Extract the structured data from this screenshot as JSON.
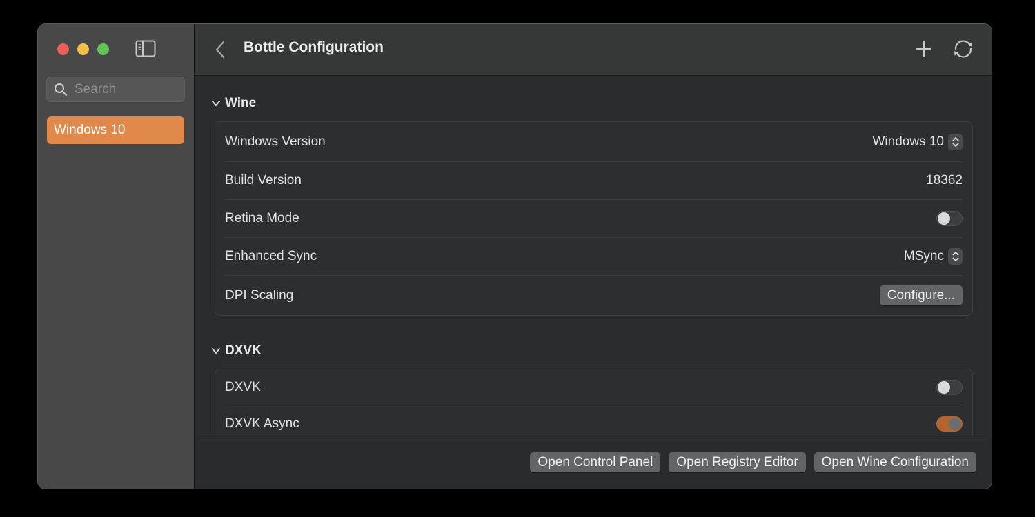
{
  "sidebar": {
    "search_placeholder": "Search",
    "search_value": "",
    "items": [
      {
        "label": "Windows 10",
        "selected": true
      }
    ]
  },
  "toolbar": {
    "title": "Bottle Configuration",
    "back_icon": "chevron-left-icon",
    "add_icon": "plus-icon",
    "refresh_icon": "refresh-icon"
  },
  "sections": {
    "wine": {
      "title": "Wine",
      "rows": {
        "windows_version": {
          "label": "Windows Version",
          "value": "Windows 10"
        },
        "build_version": {
          "label": "Build Version",
          "value": "18362"
        },
        "retina_mode": {
          "label": "Retina Mode",
          "value": false
        },
        "enhanced_sync": {
          "label": "Enhanced Sync",
          "value": "MSync"
        },
        "dpi_scaling": {
          "label": "DPI Scaling",
          "button": "Configure..."
        }
      }
    },
    "dxvk": {
      "title": "DXVK",
      "rows": {
        "dxvk": {
          "label": "DXVK",
          "value": false
        },
        "dxvk_async": {
          "label": "DXVK Async",
          "value": true
        }
      }
    }
  },
  "footer": {
    "control_panel": "Open Control Panel",
    "registry_editor": "Open Registry Editor",
    "wine_configuration": "Open Wine Configuration"
  },
  "colors": {
    "accent": "#e0894a",
    "toggle_on": "#b46431"
  }
}
